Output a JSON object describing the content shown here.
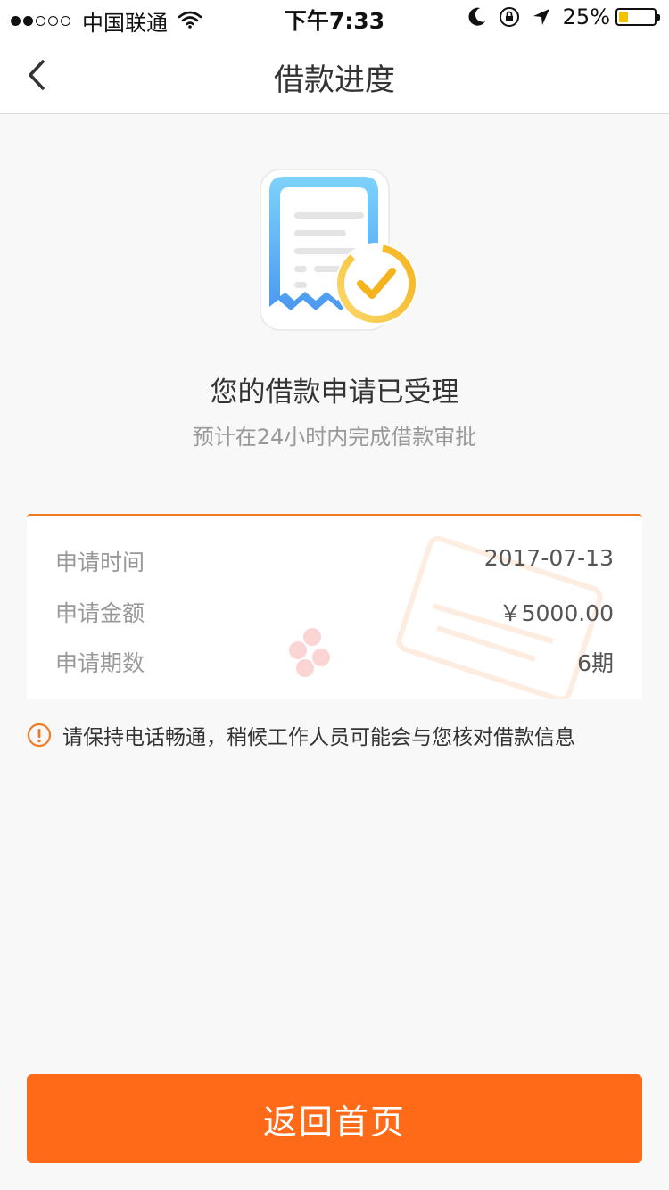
{
  "status_bar": {
    "carrier": "中国联通",
    "time": "下午7:33",
    "battery_percent": "25%",
    "battery_level": 0.25,
    "signal_dots_filled": 2,
    "signal_dots_total": 5,
    "icons": [
      "wifi-icon",
      "moon-icon",
      "rotation-lock-icon",
      "location-arrow-icon",
      "battery-icon"
    ]
  },
  "nav": {
    "title": "借款进度",
    "back_icon": "chevron-left-icon"
  },
  "hero": {
    "icon": "receipt-checkmark-icon",
    "headline": "您的借款申请已受理",
    "subline": "预计在24小时内完成借款审批"
  },
  "details": {
    "rows": [
      {
        "label": "申请时间",
        "value": "2017-07-13"
      },
      {
        "label": "申请金额",
        "value": "￥5000.00"
      },
      {
        "label": "申请期数",
        "value": "6期"
      }
    ]
  },
  "notice": {
    "icon": "warning-circle-icon",
    "text": "请保持电话畅通，稍候工作人员可能会与您核对借款信息"
  },
  "footer": {
    "button_label": "返回首页"
  },
  "colors": {
    "accent": "#fe6a18",
    "card_top_border": "#f07a22",
    "background": "#f8f8f8",
    "check_gold": "#f7c744",
    "receipt_blue": "#5ab0f5"
  }
}
